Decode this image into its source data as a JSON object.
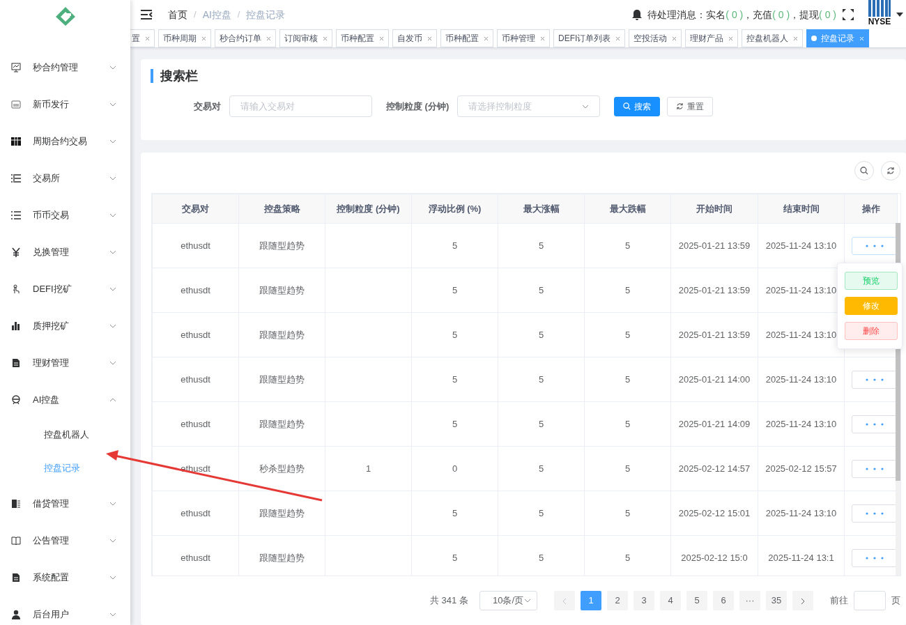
{
  "sidebar": {
    "items": [
      {
        "label": "秒合约管理",
        "expanded": false
      },
      {
        "label": "新币发行",
        "expanded": false
      },
      {
        "label": "周期合约交易",
        "expanded": false
      },
      {
        "label": "交易所",
        "expanded": false
      },
      {
        "label": "币币交易",
        "expanded": false
      },
      {
        "label": "兑换管理",
        "expanded": false
      },
      {
        "label": "DEFI挖矿",
        "expanded": false
      },
      {
        "label": "质押挖矿",
        "expanded": false
      },
      {
        "label": "理财管理",
        "expanded": false
      },
      {
        "label": "AI控盘",
        "expanded": true,
        "children": [
          {
            "label": "控盘机器人",
            "selected": false
          },
          {
            "label": "控盘记录",
            "selected": true
          }
        ]
      },
      {
        "label": "借贷管理",
        "expanded": false
      },
      {
        "label": "公告管理",
        "expanded": false
      },
      {
        "label": "系统配置",
        "expanded": false
      },
      {
        "label": "后台用户",
        "expanded": false
      }
    ]
  },
  "breadcrumb": {
    "separator": "/",
    "items": [
      "首页",
      "AI控盘",
      "控盘记录"
    ]
  },
  "notice": {
    "label": "待处理消息：",
    "items": [
      {
        "label": "实名",
        "count": "( 0 )"
      },
      {
        "label": "，充值",
        "count": "( 0 )"
      },
      {
        "label": "，提现",
        "count": "( 0 )"
      }
    ]
  },
  "avatar": {
    "label": "NYSE"
  },
  "tabs": [
    {
      "label": "置",
      "selected": false
    },
    {
      "label": "币种周期",
      "selected": false
    },
    {
      "label": "秒合约订单",
      "selected": false
    },
    {
      "label": "订阅审核",
      "selected": false
    },
    {
      "label": "币种配置",
      "selected": false
    },
    {
      "label": "自发币",
      "selected": false
    },
    {
      "label": "币种配置",
      "selected": false
    },
    {
      "label": "币种管理",
      "selected": false
    },
    {
      "label": "DEFI订单列表",
      "selected": false
    },
    {
      "label": "空投活动",
      "selected": false
    },
    {
      "label": "理财产品",
      "selected": false
    },
    {
      "label": "控盘机器人",
      "selected": false
    },
    {
      "label": "控盘记录",
      "selected": true
    }
  ],
  "search": {
    "title": "搜索栏",
    "fields": [
      {
        "label": "交易对",
        "placeholder": "请输入交易对",
        "kind": "input"
      },
      {
        "label": "控制粒度 (分钟)",
        "placeholder": "请选择控制粒度",
        "kind": "select"
      }
    ],
    "buttons": [
      {
        "label": "搜索",
        "kind": "primary"
      },
      {
        "label": "重置",
        "kind": "reset"
      }
    ]
  },
  "table": {
    "columns": [
      "交易对",
      "控盘策略",
      "控制粒度 (分钟)",
      "浮动比例 (%)",
      "最大涨幅",
      "最大跌幅",
      "开始时间",
      "结束时间",
      "操作"
    ],
    "rows": [
      {
        "cells": [
          "ethusdt",
          "跟随型趋势",
          null,
          "5",
          "5",
          "5",
          "2025-01-21 13:59",
          "2025-11-24 13:10"
        ]
      },
      {
        "cells": [
          "ethusdt",
          "跟随型趋势",
          null,
          "5",
          "5",
          "5",
          "2025-01-21 13:59",
          "2025-11-24 13:10"
        ]
      },
      {
        "cells": [
          "ethusdt",
          "跟随型趋势",
          null,
          "5",
          "5",
          "5",
          "2025-01-21 13:59",
          "2025-11-24 13:10"
        ]
      },
      {
        "cells": [
          "ethusdt",
          "跟随型趋势",
          null,
          "5",
          "5",
          "5",
          "2025-01-21 14:00",
          "2025-11-24 13:10"
        ]
      },
      {
        "cells": [
          "ethusdt",
          "跟随型趋势",
          null,
          "5",
          "5",
          "5",
          "2025-01-21 14:09",
          "2025-11-24 13:10"
        ]
      },
      {
        "cells": [
          "ethusdt",
          "秒杀型趋势",
          "1",
          "0",
          "5",
          "5",
          "2025-02-12 14:57",
          "2025-02-12 15:57"
        ]
      },
      {
        "cells": [
          "ethusdt",
          "跟随型趋势",
          null,
          "5",
          "5",
          "5",
          "2025-02-12 15:01",
          "2025-11-24 13:10"
        ]
      },
      {
        "cells": [
          "ethusdt",
          "跟随型趋势",
          null,
          "5",
          "5",
          "5",
          "2025-02-12 15:0",
          "2025-11-24 13:1"
        ]
      }
    ],
    "menu": {
      "open": true,
      "items": [
        {
          "label": "预览",
          "kind": "preview"
        },
        {
          "label": "修改",
          "kind": "edit"
        },
        {
          "label": "删除",
          "kind": "delete"
        }
      ]
    }
  },
  "pagination": {
    "total": "共 341 条",
    "page_size": "10条/页",
    "pages": [
      {
        "label": "1",
        "selected": true
      },
      {
        "label": "2",
        "selected": false
      },
      {
        "label": "3",
        "selected": false
      },
      {
        "label": "4",
        "selected": false
      },
      {
        "label": "5",
        "selected": false
      },
      {
        "label": "6",
        "selected": false
      },
      {
        "label": "···",
        "selected": false
      },
      {
        "label": "35",
        "selected": false
      }
    ],
    "goto": "前往",
    "unit": "页"
  }
}
